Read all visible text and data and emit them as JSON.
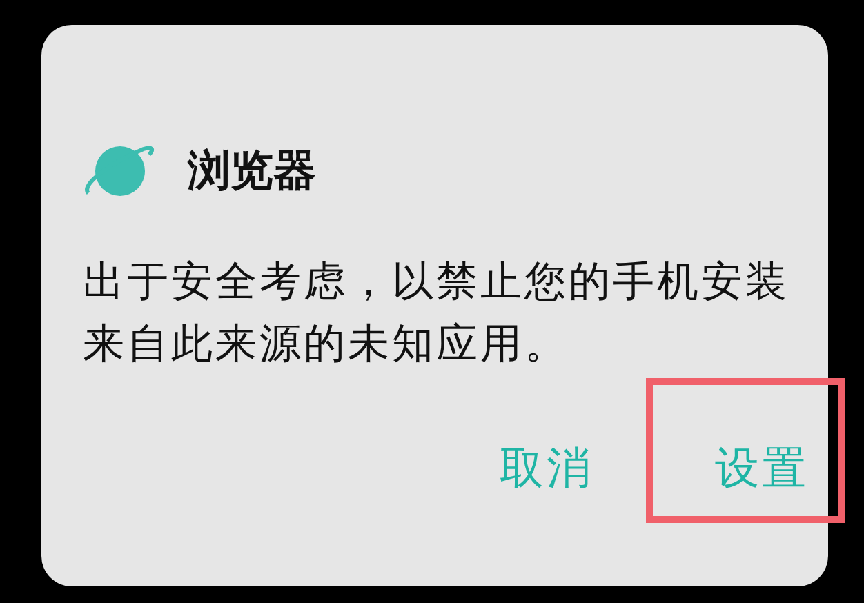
{
  "dialog": {
    "title": "浏览器",
    "message": "出于安全考虑，以禁止您的手机安装来自此来源的未知应用。",
    "buttons": [
      {
        "label": "取消",
        "highlighted": false
      },
      {
        "label": "设置",
        "highlighted": true
      }
    ]
  }
}
